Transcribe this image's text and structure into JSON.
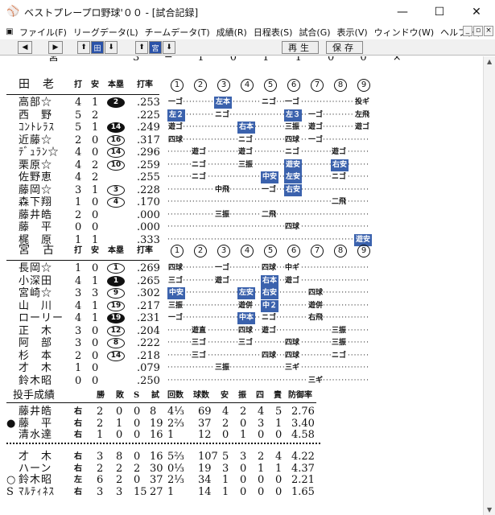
{
  "window": {
    "title": "ベストプレープロ野球'００ - [試合記録]",
    "controls": [
      "—",
      "☐",
      "✕"
    ]
  },
  "menubar": {
    "items": [
      "ファイル(F)",
      "リーグデータ(L)",
      "チームデータ(T)",
      "成績(R)",
      "日程表(S)",
      "試合(G)",
      "表示(V)",
      "ウィンドウ(W)",
      "ヘルプ(H)"
    ],
    "mdi_controls": [
      "_",
      "▫",
      "×"
    ]
  },
  "toolbar": {
    "btn_prev": "◀",
    "btn_next": "▶",
    "btn_up1": "⬆",
    "team_label": "田",
    "btn_down1": "⬇",
    "btn_up2": "⬆",
    "team2_label": "宮",
    "btn_down2": "⬇",
    "replay": "再生",
    "save": "保存"
  },
  "colors": {
    "highlight": "#3b62ad",
    "text": "#111111"
  },
  "header_labels": {
    "ab": "打",
    "hits": "安",
    "hr": "本塁",
    "avg": "打率",
    "innings": [
      "①",
      "②",
      "③",
      "④",
      "⑤",
      "⑥",
      "⑦",
      "⑧",
      "⑨"
    ]
  },
  "top_partial": {
    "name": "宮",
    "values": "3 ─ 1 0 1 1 0 0 ×"
  },
  "team1": {
    "name": "田　老",
    "players": [
      {
        "name": "高部☆",
        "ab": "4",
        "h": "1",
        "hr": "2",
        "hr_style": "filled",
        "avg": ".253",
        "pa": [
          {
            "inn": 1,
            "r": "一ゴ"
          },
          {
            "inn": 3,
            "r": "左本",
            "hl": true
          },
          {
            "inn": 5,
            "r": "ニゴ"
          },
          {
            "inn": 6,
            "r": "一ゴ"
          },
          {
            "inn": 9,
            "r": "投ギ"
          }
        ]
      },
      {
        "name": "西　野",
        "ab": "5",
        "h": "2",
        "hr": "",
        "avg": ".225",
        "pa": [
          {
            "inn": 1,
            "r": "左２",
            "hl": true
          },
          {
            "inn": 3,
            "r": "ニゴ"
          },
          {
            "inn": 6,
            "r": "左３",
            "hl": true
          },
          {
            "inn": 7,
            "r": "一ゴ"
          },
          {
            "inn": 9,
            "r": "左飛"
          }
        ]
      },
      {
        "name": "ｺﾝﾄﾚﾗｽ",
        "ab": "5",
        "h": "1",
        "hr": "14",
        "hr_style": "filled",
        "avg": ".249",
        "pa": [
          {
            "inn": 1,
            "r": "遊ゴ"
          },
          {
            "inn": 4,
            "r": "右本",
            "hl": true
          },
          {
            "inn": 6,
            "r": "三振"
          },
          {
            "inn": 7,
            "r": "遊ゴ"
          },
          {
            "inn": 9,
            "r": "遊ゴ"
          }
        ]
      },
      {
        "name": "近藤☆",
        "ab": "2",
        "h": "0",
        "hr": "16",
        "hr_style": "outline",
        "avg": ".317",
        "pa": [
          {
            "inn": 1,
            "r": "四球"
          },
          {
            "inn": 4,
            "r": "ニゴ"
          },
          {
            "inn": 6,
            "r": "四球"
          },
          {
            "inn": 7,
            "r": "一ゴ"
          }
        ]
      },
      {
        "name": "ﾃﾞｭﾗﾝ☆",
        "ab": "4",
        "h": "0",
        "hr": "14",
        "hr_style": "outline",
        "avg": ".296",
        "pa": [
          {
            "inn": 2,
            "r": "遊ゴ"
          },
          {
            "inn": 4,
            "r": "遊ゴ"
          },
          {
            "inn": 6,
            "r": "ニゴ"
          },
          {
            "inn": 8,
            "r": "遊ゴ"
          }
        ]
      },
      {
        "name": "栗原☆",
        "ab": "4",
        "h": "2",
        "hr": "10",
        "hr_style": "outline",
        "avg": ".259",
        "pa": [
          {
            "inn": 2,
            "r": "ニゴ"
          },
          {
            "inn": 4,
            "r": "三振"
          },
          {
            "inn": 6,
            "r": "遊安",
            "hl": true
          },
          {
            "inn": 8,
            "r": "右安",
            "hl": true
          }
        ]
      },
      {
        "name": "佐野恵",
        "ab": "4",
        "h": "2",
        "hr": "",
        "avg": ".255",
        "pa": [
          {
            "inn": 2,
            "r": "ニゴ"
          },
          {
            "inn": 5,
            "r": "中安",
            "hl": true
          },
          {
            "inn": 6,
            "r": "左安",
            "hl": true
          },
          {
            "inn": 8,
            "r": "ニゴ"
          }
        ]
      },
      {
        "name": "藤岡☆",
        "ab": "3",
        "h": "1",
        "hr": "3",
        "hr_style": "outline",
        "avg": ".228",
        "pa": [
          {
            "inn": 3,
            "r": "中飛"
          },
          {
            "inn": 5,
            "r": "一ゴ"
          },
          {
            "inn": 6,
            "r": "右安",
            "hl": true
          }
        ]
      },
      {
        "name": "森下翔",
        "ab": "1",
        "h": "0",
        "hr": "4",
        "hr_style": "outline",
        "avg": ".170",
        "pa": [
          {
            "inn": 8,
            "r": "二飛"
          }
        ]
      },
      {
        "name": "藤井皓",
        "ab": "2",
        "h": "0",
        "hr": "",
        "avg": ".000",
        "pa": [
          {
            "inn": 3,
            "r": "三振"
          },
          {
            "inn": 5,
            "r": "二飛"
          }
        ]
      },
      {
        "name": "藤　平",
        "ab": "0",
        "h": "0",
        "hr": "",
        "avg": ".000",
        "pa": [
          {
            "inn": 6,
            "r": "四球"
          }
        ]
      },
      {
        "name": "梶　原",
        "ab": "1",
        "h": "1",
        "hr": "",
        "avg": ".333",
        "pa": [
          {
            "inn": 9,
            "r": "遊安",
            "hl": true
          }
        ]
      }
    ]
  },
  "team2": {
    "name": "宮　古",
    "players": [
      {
        "name": "長岡☆",
        "ab": "1",
        "h": "0",
        "hr": "1",
        "hr_style": "outline",
        "avg": ".269",
        "pa": [
          {
            "inn": 1,
            "r": "四球"
          },
          {
            "inn": 3,
            "r": "一ゴ"
          },
          {
            "inn": 5,
            "r": "四球"
          },
          {
            "inn": 6,
            "r": "中ギ"
          }
        ]
      },
      {
        "name": "小深田",
        "ab": "4",
        "h": "1",
        "hr": "1",
        "hr_style": "filled",
        "avg": ".265",
        "pa": [
          {
            "inn": 1,
            "r": "三ゴ"
          },
          {
            "inn": 3,
            "r": "遊ゴ"
          },
          {
            "inn": 5,
            "r": "右本",
            "hl": true
          },
          {
            "inn": 6,
            "r": "遊ゴ"
          }
        ]
      },
      {
        "name": "宮崎☆",
        "ab": "3",
        "h": "3",
        "hr": "9",
        "hr_style": "outline",
        "avg": ".302",
        "pa": [
          {
            "inn": 1,
            "r": "中安",
            "hl": true
          },
          {
            "inn": 4,
            "r": "左安",
            "hl": true
          },
          {
            "inn": 5,
            "r": "右安",
            "hl": true
          },
          {
            "inn": 7,
            "r": "四球"
          }
        ]
      },
      {
        "name": "山　川",
        "ab": "4",
        "h": "1",
        "hr": "19",
        "hr_style": "outline",
        "avg": ".217",
        "pa": [
          {
            "inn": 1,
            "r": "三振"
          },
          {
            "inn": 4,
            "r": "遊併"
          },
          {
            "inn": 5,
            "r": "中２",
            "hl": true
          },
          {
            "inn": 7,
            "r": "遊併"
          }
        ]
      },
      {
        "name": "ローリー",
        "ab": "4",
        "h": "1",
        "hr": "19",
        "hr_style": "filled",
        "avg": ".231",
        "pa": [
          {
            "inn": 1,
            "r": "一ゴ"
          },
          {
            "inn": 4,
            "r": "中本",
            "hl": true
          },
          {
            "inn": 5,
            "r": "ニゴ"
          },
          {
            "inn": 7,
            "r": "右飛"
          }
        ]
      },
      {
        "name": "正　木",
        "ab": "3",
        "h": "0",
        "hr": "12",
        "hr_style": "outline",
        "avg": ".204",
        "pa": [
          {
            "inn": 2,
            "r": "遊直"
          },
          {
            "inn": 4,
            "r": "四球"
          },
          {
            "inn": 5,
            "r": "遊ゴ"
          },
          {
            "inn": 8,
            "r": "三振"
          }
        ]
      },
      {
        "name": "阿　部",
        "ab": "3",
        "h": "0",
        "hr": "8",
        "hr_style": "outline",
        "avg": ".222",
        "pa": [
          {
            "inn": 2,
            "r": "三ゴ"
          },
          {
            "inn": 4,
            "r": "三ゴ"
          },
          {
            "inn": 6,
            "r": "四球"
          },
          {
            "inn": 8,
            "r": "三振"
          }
        ]
      },
      {
        "name": "杉　本",
        "ab": "2",
        "h": "0",
        "hr": "14",
        "hr_style": "outline",
        "avg": ".218",
        "pa": [
          {
            "inn": 2,
            "r": "三ゴ"
          },
          {
            "inn": 5,
            "r": "四球"
          },
          {
            "inn": 6,
            "r": "四球"
          },
          {
            "inn": 8,
            "r": "ニゴ"
          }
        ]
      },
      {
        "name": "才　木",
        "ab": "1",
        "h": "0",
        "hr": "",
        "avg": ".079",
        "pa": [
          {
            "inn": 3,
            "r": "三振"
          },
          {
            "inn": 6,
            "r": "三ギ"
          }
        ]
      },
      {
        "name": "鈴木昭",
        "ab": "0",
        "h": "0",
        "hr": "",
        "avg": ".250",
        "pa": [
          {
            "inn": 7,
            "r": "三ギ"
          }
        ]
      }
    ]
  },
  "pitching": {
    "title": "投手成績",
    "headers": [
      "勝",
      "敗",
      "S",
      "試",
      "回数",
      "球数",
      "安",
      "振",
      "四",
      "責",
      "防御率"
    ],
    "team1": [
      {
        "mark": "",
        "name": "藤井皓",
        "hand": "右",
        "vals": [
          "2",
          "0",
          "0",
          "8",
          "4⅓",
          "69",
          "4",
          "2",
          "4",
          "5",
          "2.76"
        ]
      },
      {
        "mark": "●",
        "name": "藤　平",
        "hand": "右",
        "vals": [
          "2",
          "1",
          "0",
          "19",
          "2⅔",
          "37",
          "2",
          "0",
          "3",
          "1",
          "3.40"
        ]
      },
      {
        "mark": "",
        "name": "清水達",
        "hand": "右",
        "vals": [
          "1",
          "0",
          "0",
          "16",
          "1",
          "12",
          "0",
          "1",
          "0",
          "0",
          "4.58"
        ]
      }
    ],
    "team2": [
      {
        "mark": "",
        "name": "才　木",
        "hand": "右",
        "vals": [
          "3",
          "8",
          "0",
          "16",
          "5⅔",
          "107",
          "5",
          "3",
          "2",
          "4",
          "4.22"
        ]
      },
      {
        "mark": "",
        "name": "ハーン",
        "hand": "右",
        "vals": [
          "2",
          "2",
          "2",
          "30",
          "0⅓",
          "19",
          "3",
          "0",
          "1",
          "1",
          "4.37"
        ]
      },
      {
        "mark": "○",
        "name": "鈴木昭",
        "hand": "左",
        "vals": [
          "6",
          "2",
          "0",
          "37",
          "2⅓",
          "34",
          "1",
          "0",
          "0",
          "0",
          "2.21"
        ]
      },
      {
        "mark": "S",
        "name": "ﾏﾙﾃｨﾈｽ",
        "hand": "右",
        "vals": [
          "3",
          "3",
          "15",
          "27",
          "1",
          "14",
          "1",
          "0",
          "0",
          "0",
          "1.65"
        ]
      }
    ]
  }
}
